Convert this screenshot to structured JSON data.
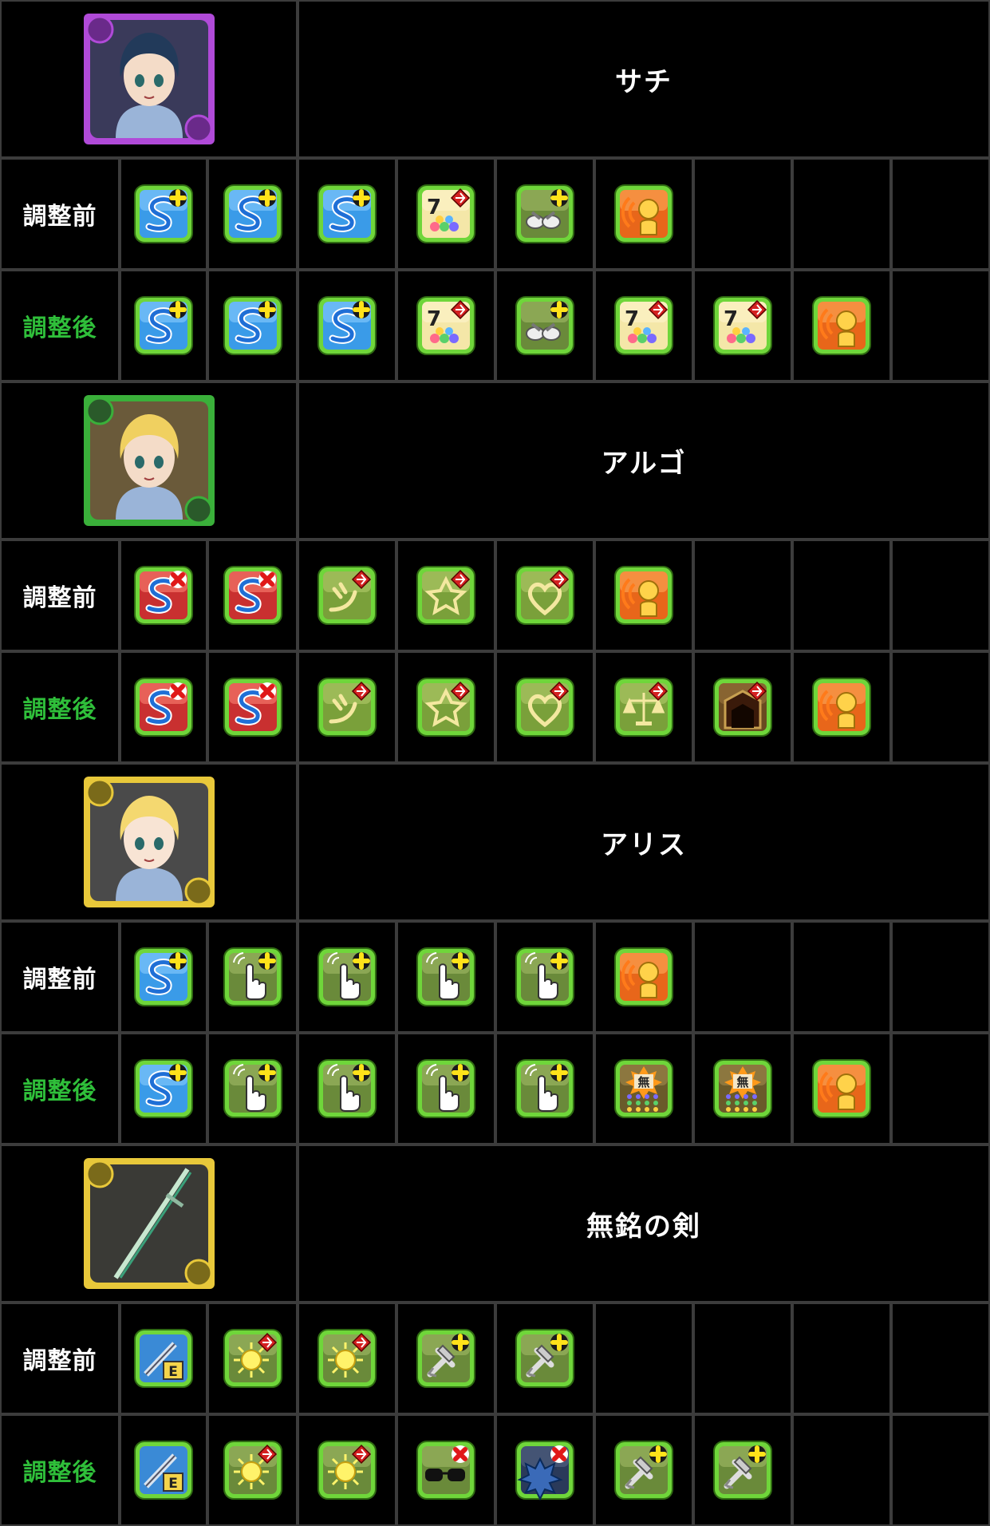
{
  "colors": {
    "before_label": "#ffffff",
    "after_label": "#2fbf3a",
    "grid_line": "#3c3c3c",
    "background": "#000000"
  },
  "characters": [
    {
      "name": "サチ",
      "portrait": {
        "icon": "sachi-portrait-icon",
        "attribute": "dark"
      },
      "rows": [
        {
          "label": "調整前",
          "state": "before",
          "awakenings": [
            "skill-boost-plus-icon",
            "skill-boost-plus-icon",
            "skill-boost-plus-icon",
            "seven-combo-icon",
            "bind-resist-plus-icon",
            "voice-awakening-icon"
          ]
        },
        {
          "label": "調整後",
          "state": "after",
          "awakenings": [
            "skill-boost-plus-icon",
            "skill-boost-plus-icon",
            "skill-boost-plus-icon",
            "seven-combo-icon",
            "bind-resist-plus-icon",
            "seven-combo-icon",
            "seven-combo-icon",
            "voice-awakening-icon"
          ]
        }
      ]
    },
    {
      "name": "アルゴ",
      "portrait": {
        "icon": "argo-portrait-icon",
        "attribute": "wood"
      },
      "rows": [
        {
          "label": "調整前",
          "state": "before",
          "awakenings": [
            "skill-delay-resist-icon",
            "skill-delay-resist-icon",
            "dragon-killer-icon",
            "god-killer-icon",
            "healer-killer-icon",
            "voice-awakening-icon"
          ]
        },
        {
          "label": "調整後",
          "state": "after",
          "awakenings": [
            "skill-delay-resist-icon",
            "skill-delay-resist-icon",
            "dragon-killer-icon",
            "god-killer-icon",
            "healer-killer-icon",
            "balance-killer-icon",
            "devil-killer-icon",
            "voice-awakening-icon"
          ]
        }
      ]
    },
    {
      "name": "アリス",
      "portrait": {
        "icon": "alice-portrait-icon",
        "attribute": "light"
      },
      "rows": [
        {
          "label": "調整前",
          "state": "before",
          "awakenings": [
            "skill-boost-plus-icon",
            "extend-time-plus-icon",
            "extend-time-plus-icon",
            "extend-time-plus-icon",
            "extend-time-plus-icon",
            "voice-awakening-icon"
          ]
        },
        {
          "label": "調整後",
          "state": "after",
          "awakenings": [
            "skill-boost-plus-icon",
            "extend-time-plus-icon",
            "extend-time-plus-icon",
            "extend-time-plus-icon",
            "extend-time-plus-icon",
            "no-skyfall-combo-icon",
            "no-skyfall-combo-icon",
            "voice-awakening-icon"
          ]
        }
      ]
    },
    {
      "name": "無銘の剣",
      "portrait": {
        "icon": "nameless-sword-portrait-icon",
        "attribute": "light"
      },
      "rows": [
        {
          "label": "調整前",
          "state": "before",
          "awakenings": [
            "equip-assist-icon",
            "light-row-plus-icon",
            "light-row-plus-icon",
            "guard-break-plus-icon",
            "guard-break-plus-icon"
          ]
        },
        {
          "label": "調整後",
          "state": "after",
          "awakenings": [
            "equip-assist-icon",
            "light-row-plus-icon",
            "light-row-plus-icon",
            "blind-resist-plus-icon",
            "jammer-resist-plus-icon",
            "guard-break-plus-icon",
            "guard-break-plus-icon"
          ]
        }
      ]
    }
  ]
}
